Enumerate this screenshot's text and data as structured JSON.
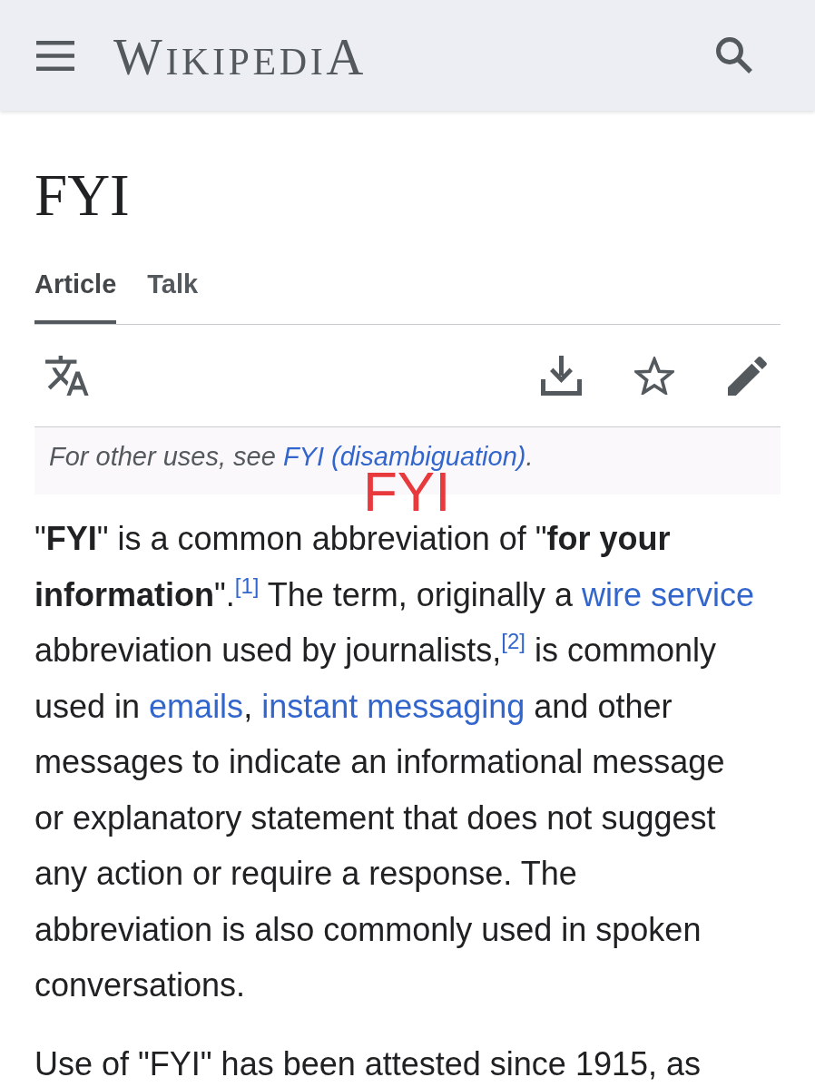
{
  "header": {
    "logo": "WIKIPEDIA"
  },
  "page_title": "FYI",
  "tabs": [
    {
      "label": "Article",
      "selected": true
    },
    {
      "label": "Talk",
      "selected": false
    }
  ],
  "hatnote": [
    {
      "kind": "text",
      "text": "For other uses, see "
    },
    {
      "kind": "link",
      "text": "FYI (disambiguation)"
    },
    {
      "kind": "text",
      "text": "."
    }
  ],
  "overlay_caption": "FYI",
  "paragraphs": [
    [
      {
        "kind": "text",
        "text": "\"**FYI**\" is a common abbreviation of \"**for your information**\"."
      },
      {
        "kind": "ref",
        "text": "[1]"
      },
      {
        "kind": "text",
        "text": " The term, originally a "
      },
      {
        "kind": "link",
        "text": "wire service"
      },
      {
        "kind": "text",
        "text": " abbreviation used by journalists,"
      },
      {
        "kind": "ref",
        "text": "[2]"
      },
      {
        "kind": "text",
        "text": " is commonly used in "
      },
      {
        "kind": "link",
        "text": "emails"
      },
      {
        "kind": "text",
        "text": ", "
      },
      {
        "kind": "link",
        "text": "instant messaging"
      },
      {
        "kind": "text",
        "text": " and other messages to indicate an informational message or explanatory statement that does not suggest any action or require a response. The abbreviation is also commonly used in spoken conversations."
      }
    ],
    [
      {
        "kind": "text",
        "text": "Use of \"FYI\" has been attested since 1915, as"
      }
    ]
  ]
}
